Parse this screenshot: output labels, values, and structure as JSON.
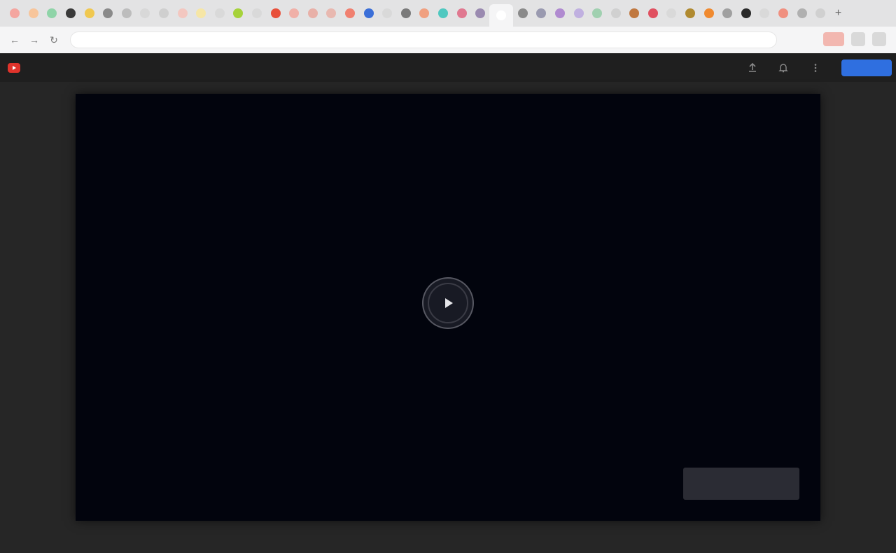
{
  "browser": {
    "tabs": [
      {
        "icon": "favicon",
        "color": "#f4a6a0"
      },
      {
        "icon": "favicon",
        "color": "#f7c59b"
      },
      {
        "icon": "favicon",
        "color": "#8fd4a8"
      },
      {
        "icon": "favicon",
        "color": "#3a3a3a"
      },
      {
        "icon": "favicon",
        "color": "#f0c850"
      },
      {
        "icon": "favicon",
        "color": "#8a8a8a"
      },
      {
        "icon": "favicon",
        "color": "#bdbdbd"
      },
      {
        "icon": "favicon",
        "color": "#d8d8d8"
      },
      {
        "icon": "favicon",
        "color": "#cfcfcf"
      },
      {
        "icon": "favicon",
        "color": "#f3c7c0"
      },
      {
        "icon": "favicon",
        "color": "#f6e6a6"
      },
      {
        "icon": "favicon",
        "color": "#d9d9d9"
      },
      {
        "icon": "favicon",
        "color": "#a6d23a"
      },
      {
        "icon": "favicon",
        "color": "#d9d9d9"
      },
      {
        "icon": "favicon",
        "color": "#e8503a"
      },
      {
        "icon": "favicon",
        "color": "#f0b0a8"
      },
      {
        "icon": "favicon",
        "color": "#e8b0a8"
      },
      {
        "icon": "favicon",
        "color": "#e8b8b0"
      },
      {
        "icon": "favicon",
        "color": "#f08070"
      },
      {
        "icon": "favicon",
        "color": "#3b6fd8"
      },
      {
        "icon": "favicon",
        "color": "#d9d9d9"
      },
      {
        "icon": "favicon",
        "color": "#7a7a7a"
      },
      {
        "icon": "favicon",
        "color": "#f0a080"
      },
      {
        "icon": "favicon",
        "color": "#4fc8c0"
      },
      {
        "icon": "favicon",
        "color": "#e07890"
      },
      {
        "icon": "favicon",
        "color": "#9a8ab0"
      },
      {
        "icon": "favicon",
        "color": "#ffffff",
        "active": true
      },
      {
        "icon": "favicon",
        "color": "#8a8a8a"
      },
      {
        "icon": "favicon",
        "color": "#9a9ab0"
      },
      {
        "icon": "favicon",
        "color": "#b08ad0"
      },
      {
        "icon": "favicon",
        "color": "#c0b0e0"
      },
      {
        "icon": "favicon",
        "color": "#a0d0b0"
      },
      {
        "icon": "favicon",
        "color": "#d0d0d0"
      },
      {
        "icon": "favicon",
        "color": "#c07840"
      },
      {
        "icon": "favicon",
        "color": "#e05060"
      },
      {
        "icon": "favicon",
        "color": "#d9d9d9"
      },
      {
        "icon": "favicon",
        "color": "#b08a30"
      },
      {
        "icon": "favicon",
        "color": "#f08a30"
      },
      {
        "icon": "favicon",
        "color": "#a0a0a0"
      },
      {
        "icon": "favicon",
        "color": "#2a2a2a"
      },
      {
        "icon": "favicon",
        "color": "#d9d9d9"
      },
      {
        "icon": "favicon",
        "color": "#f09080"
      },
      {
        "icon": "favicon",
        "color": "#b0b0b0"
      },
      {
        "icon": "favicon",
        "color": "#d0d0d0"
      }
    ],
    "new_tab_symbol": "+",
    "back_symbol": "←",
    "forward_symbol": "→",
    "reload_symbol": "↻",
    "url": ""
  },
  "app": {
    "title": "",
    "logo_color": "#e0332b",
    "primary_button_label": "",
    "accent_color": "#2f6fe0"
  },
  "player": {
    "background_color": "#02040d",
    "watermark_text": ""
  }
}
